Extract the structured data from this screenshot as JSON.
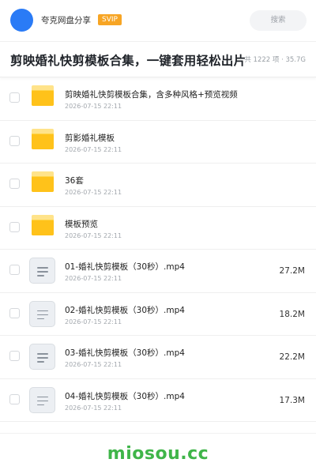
{
  "header": {
    "app_name": "夸克网盘分享",
    "badge": "SVIP",
    "search_placeholder": "搜索"
  },
  "title_bar": {
    "title": "剪映婚礼快剪模板合集，一键套用轻松出片",
    "meta": "共 1222 项 · 35.7G"
  },
  "files": [
    {
      "name": "剪映婚礼快剪模板合集，含多种风格+预览视频",
      "date": "2026-07-15 22:11",
      "size": "",
      "icon": "folder-icon"
    },
    {
      "name": "剪影婚礼模板",
      "date": "2026-07-15 22:11",
      "size": "",
      "icon": "folder-icon"
    },
    {
      "name": "36套",
      "date": "2026-07-15 22:11",
      "size": "",
      "icon": "folder-icon"
    },
    {
      "name": "模板预览",
      "date": "2026-07-15 22:11",
      "size": "",
      "icon": "folder-icon"
    },
    {
      "name": "01-婚礼快剪模板（30秒）.mp4",
      "date": "2026-07-15 22:11",
      "size": "27.2M",
      "icon": "file-icon"
    },
    {
      "name": "02-婚礼快剪模板（30秒）.mp4",
      "date": "2026-07-15 22:11",
      "size": "18.2M",
      "icon": "file-icon"
    },
    {
      "name": "03-婚礼快剪模板（30秒）.mp4",
      "date": "2026-07-15 22:11",
      "size": "22.2M",
      "icon": "file-icon"
    },
    {
      "name": "04-婚礼快剪模板（30秒）.mp4",
      "date": "2026-07-15 22:11",
      "size": "17.3M",
      "icon": "file-icon"
    }
  ],
  "watermark": "miosou.cc",
  "colors": {
    "accent": "#2a7bf6",
    "badge": "#f7a524",
    "folder": "#ffc21a",
    "watermark": "#3fb549"
  }
}
